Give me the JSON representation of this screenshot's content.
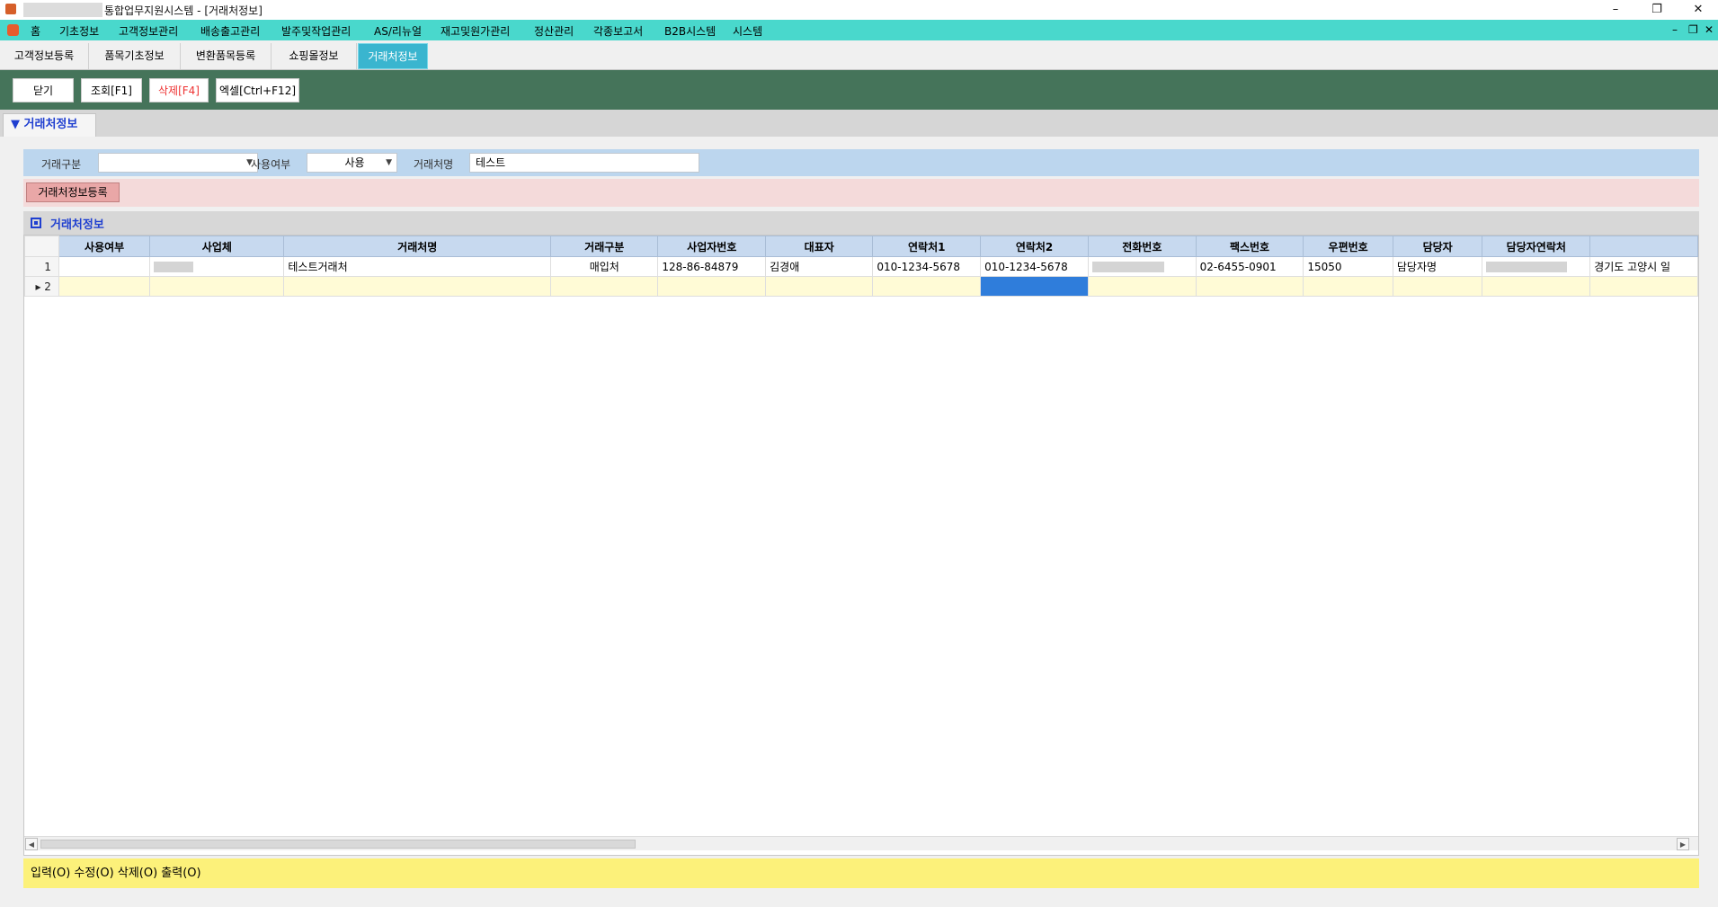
{
  "window": {
    "title": "통합업무지원시스템 - [거래처정보]",
    "controls": [
      "–",
      "❐",
      "✕"
    ]
  },
  "menu": {
    "items": [
      "홈",
      "기초정보",
      "고객정보관리",
      "배송출고관리",
      "발주및작업관리",
      "AS/리뉴얼",
      "재고및원가관리",
      "정산관리",
      "각종보고서",
      "B2B시스템",
      "시스템"
    ],
    "mdi_controls": [
      "–",
      "❐",
      "✕"
    ]
  },
  "tabs": [
    "고객정보등록",
    "품목기초정보",
    "변환품목등록",
    "쇼핑몰정보",
    "거래처정보"
  ],
  "active_tab": "거래처정보",
  "toolbar": {
    "close": "닫기",
    "search": "조회[F1]",
    "delete": "삭제[F4]",
    "excel": "엑셀[Ctrl+F12]"
  },
  "section": {
    "title": "거래처정보",
    "arrow": "▼"
  },
  "filters": {
    "type_label": "거래구분",
    "type_value": "",
    "use_label": "사용여부",
    "use_value": "사용",
    "name_label": "거래처명",
    "name_value": "테스트"
  },
  "register_button": "거래처정보등록",
  "grid": {
    "title": "거래처정보",
    "columns": [
      "사용여부",
      "사업체",
      "거래처명",
      "거래구분",
      "사업자번호",
      "대표자",
      "연락처1",
      "연락처2",
      "전화번호",
      "팩스번호",
      "우편번호",
      "담당자",
      "담당자연락처",
      ""
    ],
    "rows": [
      {
        "no": "1",
        "cells": [
          "",
          "",
          "테스트거래처",
          "매입처",
          "128-86-84879",
          "김경애",
          "010-1234-5678",
          "010-1234-5678",
          "",
          "02-6455-0901",
          "15050",
          "담당자명",
          "",
          "경기도 고양시 일"
        ]
      },
      {
        "no": "2",
        "cells": [
          "",
          "",
          "",
          "",
          "",
          "",
          "",
          "",
          "",
          "",
          "",
          "",
          "",
          ""
        ]
      }
    ]
  },
  "status": "입력(O) 수정(O) 삭제(O) 출력(O)",
  "colors": {
    "menu_bar": "#49d8cc",
    "toolbar": "#45745a",
    "active_tab": "#3ab5cf",
    "filter_bar": "#bcd6ee",
    "register_bar": "#f4dada",
    "grid_header": "#c7d9ef",
    "status_bar": "#fcf17a",
    "selected_cell": "#2f7ddb"
  }
}
